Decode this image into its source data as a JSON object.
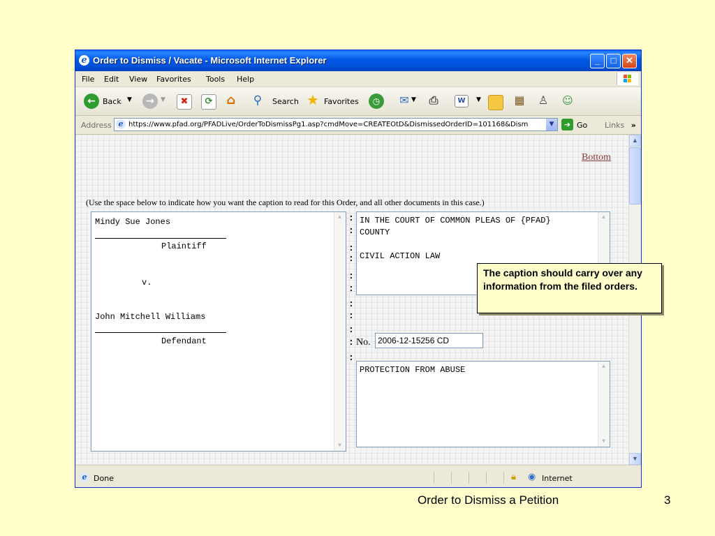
{
  "window": {
    "title": "Order to Dismiss / Vacate - Microsoft Internet Explorer",
    "controls": {
      "minimize": "_",
      "maximize": "□",
      "close": "✕"
    }
  },
  "menu": [
    "File",
    "Edit",
    "View",
    "Favorites",
    "Tools",
    "Help"
  ],
  "toolbar": {
    "back_label": "Back",
    "search_label": "Search",
    "favorites_label": "Favorites"
  },
  "address": {
    "label": "Address",
    "url": "https://www.pfad.org/PFADLive/OrderToDismissPg1.asp?cmdMove=CREATEOtD&DismissedOrderID=101168&Dism",
    "go_label": "Go",
    "links_label": "Links"
  },
  "page": {
    "bottom_link": "Bottom",
    "instruction": "(Use the space below to indicate how you want the caption to read for this Order, and all other documents in this case.)",
    "left_caption": {
      "plaintiff_name": "Mindy Sue Jones",
      "plaintiff_label": "Plaintiff",
      "versus": "v.",
      "defendant_name": "John Mitchell Williams",
      "defendant_label": "Defendant"
    },
    "court_lines": [
      "IN THE COURT OF COMMON PLEAS OF {PFAD}",
      "COUNTY",
      "",
      "CIVIL ACTION LAW"
    ],
    "case_no_label": "No.",
    "case_no_value": "2006-12-15256 CD",
    "case_type": "PROTECTION FROM ABUSE"
  },
  "status": {
    "text": "Done",
    "zone": "Internet"
  },
  "callout": "The caption should carry over any information from the filed orders.",
  "slide": {
    "footer": "Order to Dismiss a Petition",
    "page_number": "3"
  }
}
